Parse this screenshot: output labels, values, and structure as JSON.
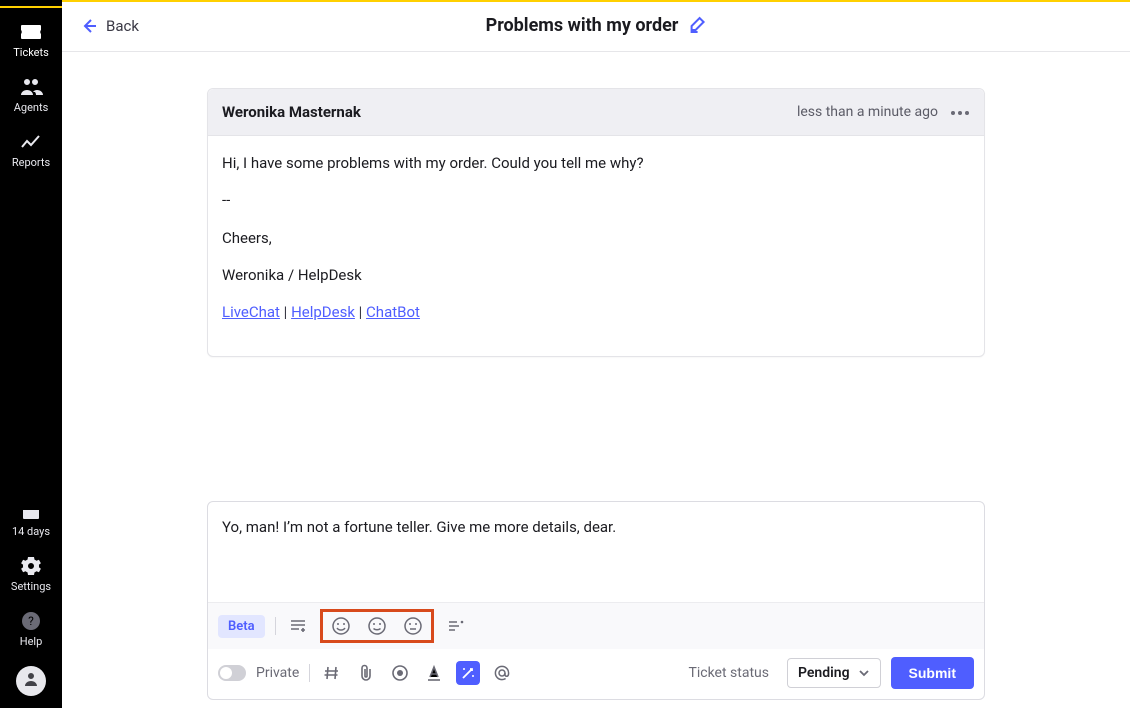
{
  "sidebar": {
    "nav": [
      {
        "label": "Tickets",
        "icon": "ticket"
      },
      {
        "label": "Agents",
        "icon": "agents"
      },
      {
        "label": "Reports",
        "icon": "reports"
      }
    ],
    "bottom": [
      {
        "label": "14 days",
        "icon": "calendar"
      },
      {
        "label": "Settings",
        "icon": "gear"
      },
      {
        "label": "Help",
        "icon": "help"
      }
    ]
  },
  "header": {
    "back_label": "Back",
    "title": "Problems with my order"
  },
  "message": {
    "author": "Weronika Masternak",
    "timestamp": "less than a minute ago",
    "body": "Hi, I have some problems with my order. Could you tell me why?",
    "sig_sep": "--",
    "sig_cheers": "Cheers,",
    "sig_name": "Weronika / HelpDesk",
    "links": {
      "livechat": "LiveChat",
      "helpdesk": "HelpDesk",
      "chatbot": "ChatBot",
      "sep": " | "
    }
  },
  "composer": {
    "text": "Yo, man! I’m not a fortune teller. Give me more details, dear.",
    "beta_label": "Beta",
    "private_label": "Private",
    "status_label": "Ticket status",
    "status_value": "Pending",
    "submit_label": "Submit"
  }
}
